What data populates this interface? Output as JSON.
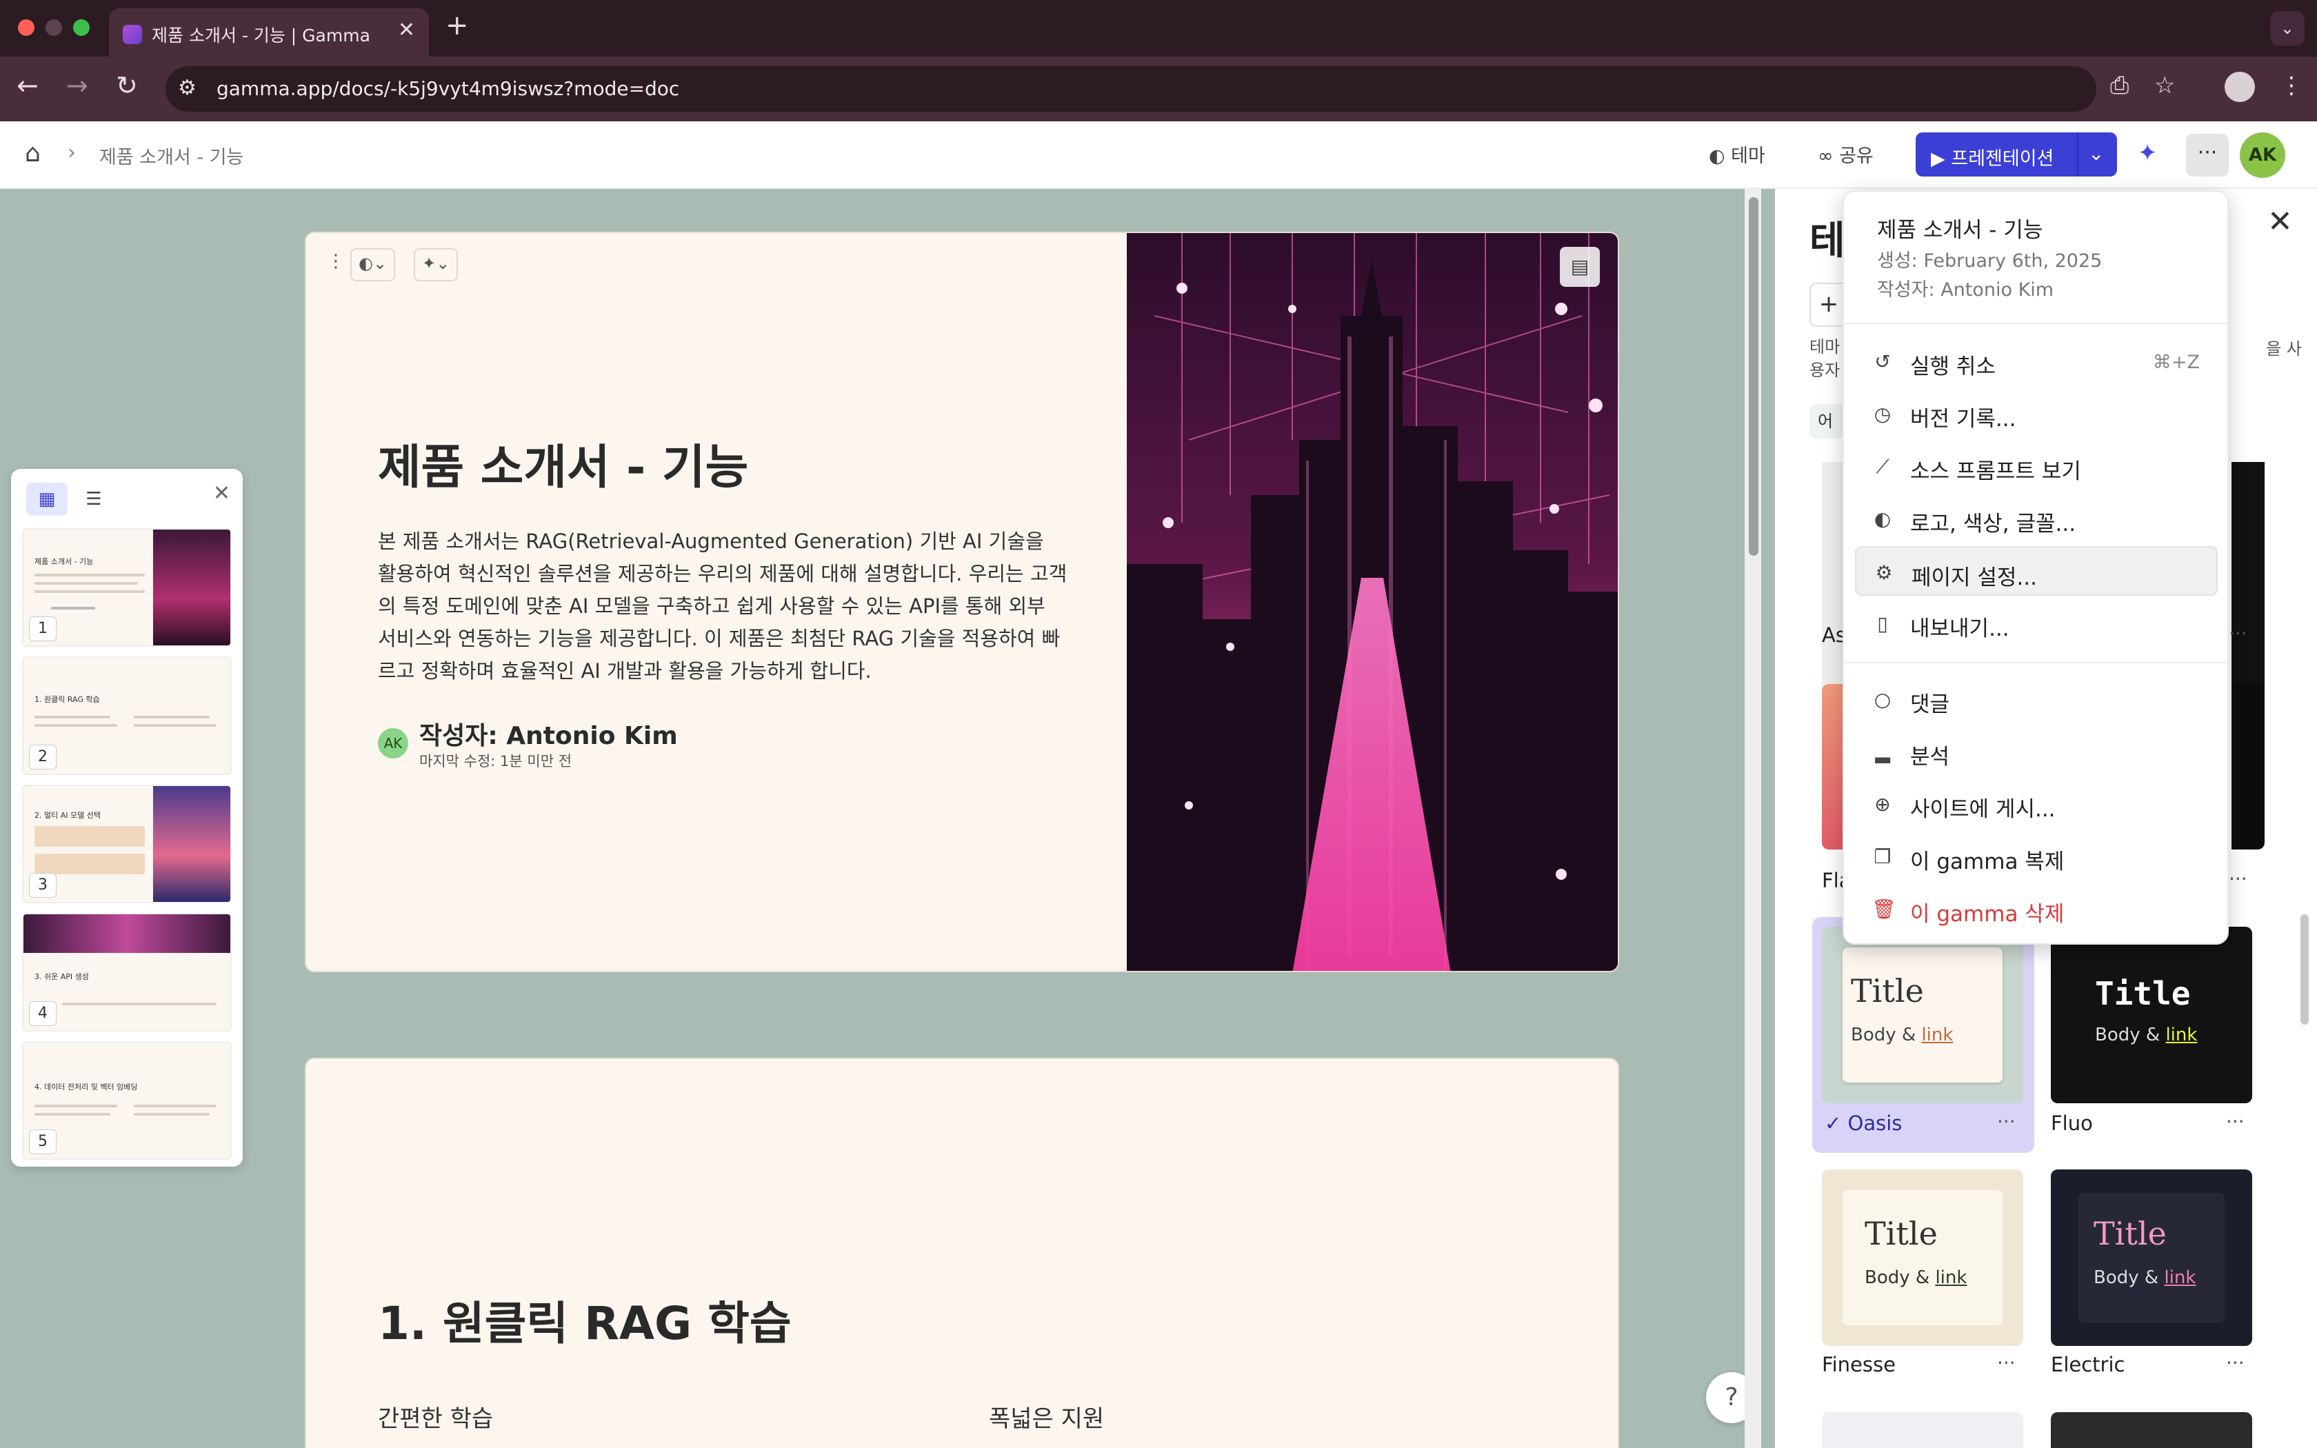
{
  "browser": {
    "tab_title": "제품 소개서 - 기능 | Gamma",
    "url": "gamma.app/docs/-k5j9vyt4m9iswsz?mode=doc"
  },
  "header": {
    "breadcrumb": "제품 소개서 - 기능",
    "theme_label": "테마",
    "share_label": "공유",
    "present_label": "프레젠테이션",
    "avatar": "AK"
  },
  "thumbnails": {
    "items": [
      {
        "num": "1",
        "title": "제품 소개서 - 기능"
      },
      {
        "num": "2",
        "title": "1. 원클릭 RAG 학습"
      },
      {
        "num": "3",
        "title": "2. 멀티 AI 모델 선택"
      },
      {
        "num": "4",
        "title": "3. 쉬운 API 생성"
      },
      {
        "num": "5",
        "title": "4. 데이터 전처리 및 벡터 임베딩"
      }
    ]
  },
  "card1": {
    "title": "제품 소개서 - 기능",
    "body": "본 제품 소개서는 RAG(Retrieval-Augmented Generation) 기반 AI 기술을 활용하여 혁신적인 솔루션을 제공하는 우리의 제품에 대해 설명합니다. 우리는 고객의 특정 도메인에 맞춘 AI 모델을 구축하고 쉽게 사용할 수 있는 API를 통해 외부 서비스와 연동하는 기능을 제공합니다. 이 제품은 최첨단 RAG 기술을 적용하여 빠르고 정확하며 효율적인 AI 개발과 활용을 가능하게 합니다.",
    "author_initials": "AK",
    "author": "작성자: Antonio Kim",
    "modified": "마지막 수정: 1분 미만 전"
  },
  "card2": {
    "title": "1. 원클릭 RAG 학습",
    "sub1": "간편한 학습",
    "sub2": "폭넓은 지원"
  },
  "help": "?",
  "theme_panel": {
    "title_partial": "테",
    "add": "+",
    "desc_line1": "테마",
    "desc_line2": "용자",
    "desc_right": "을 사",
    "chip": "어",
    "partial_names": [
      "As",
      "Fla"
    ],
    "themes": [
      {
        "name": "Oasis",
        "title": "Title",
        "body": "Body & ",
        "link": "link",
        "selected": true
      },
      {
        "name": "Fluo",
        "title": "Title",
        "body": "Body & ",
        "link": "link"
      },
      {
        "name": "Finesse",
        "title": "Title",
        "body": "Body & ",
        "link": "link"
      },
      {
        "name": "Electric",
        "title": "Title",
        "body": "Body & ",
        "link": "link"
      }
    ]
  },
  "menu": {
    "doc_title": "제품 소개서 - 기능",
    "created": "생성: February 6th, 2025",
    "author": "작성자: Antonio Kim",
    "items": [
      {
        "label": "실행 취소",
        "shortcut": "⌘+Z"
      },
      {
        "label": "버전 기록..."
      },
      {
        "label": "소스 프롬프트 보기"
      },
      {
        "label": "로고, 색상, 글꼴..."
      },
      {
        "label": "페이지 설정..."
      },
      {
        "label": "내보내기..."
      },
      {
        "label": "댓글"
      },
      {
        "label": "분석"
      },
      {
        "label": "사이트에 게시..."
      },
      {
        "label": "이 gamma 복제"
      },
      {
        "label": "이 gamma 삭제"
      }
    ]
  }
}
